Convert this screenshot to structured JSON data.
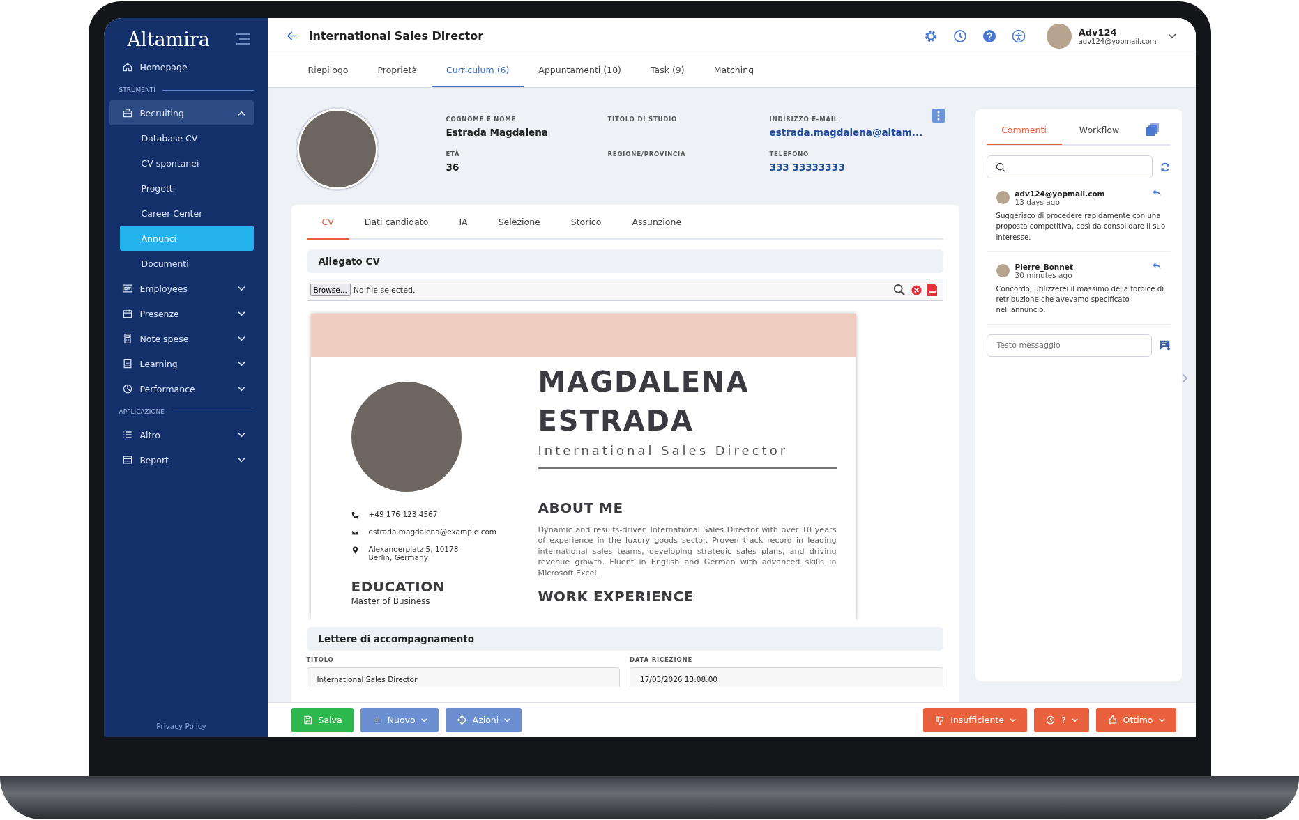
{
  "app": {
    "logo": "Altamira"
  },
  "sidebar": {
    "items": [
      {
        "kind": "link",
        "label": "Homepage"
      },
      {
        "kind": "section",
        "label": "STRUMENTI"
      },
      {
        "kind": "menu",
        "label": "Recruiting",
        "expanded": true,
        "children": [
          {
            "label": "Database CV",
            "selected": false
          },
          {
            "label": "CV spontanei",
            "selected": false
          },
          {
            "label": "Progetti",
            "selected": false
          },
          {
            "label": "Career Center",
            "selected": false
          },
          {
            "label": "Annunci",
            "selected": true
          },
          {
            "label": "Documenti",
            "selected": false
          }
        ]
      },
      {
        "kind": "menu",
        "label": "Employees",
        "expanded": false
      },
      {
        "kind": "menu",
        "label": "Presenze",
        "expanded": false
      },
      {
        "kind": "menu",
        "label": "Note spese",
        "expanded": false
      },
      {
        "kind": "menu",
        "label": "Learning",
        "expanded": false
      },
      {
        "kind": "menu",
        "label": "Performance",
        "expanded": false
      },
      {
        "kind": "section",
        "label": "APPLICAZIONE"
      },
      {
        "kind": "menu",
        "label": "Altro",
        "expanded": false
      },
      {
        "kind": "menu",
        "label": "Report",
        "expanded": false
      }
    ],
    "footer": "Privacy Policy"
  },
  "header": {
    "title": "International Sales Director",
    "user": {
      "name": "Adv124",
      "email": "adv124@yopmail.com"
    }
  },
  "tabs": [
    {
      "label": "Riepilogo",
      "selected": false
    },
    {
      "label": "Proprietà",
      "selected": false
    },
    {
      "label": "Curriculum (6)",
      "selected": true
    },
    {
      "label": "Appuntamenti (10)",
      "selected": false
    },
    {
      "label": "Task (9)",
      "selected": false
    },
    {
      "label": "Matching",
      "selected": false
    }
  ],
  "profile": {
    "fields": [
      {
        "label": "COGNOME E NOME",
        "value": "Estrada Magdalena",
        "kind": "text"
      },
      {
        "label": "TITOLO DI STUDIO"
      },
      {
        "label": "INDIRIZZO E-MAIL",
        "value": "estrada.magdalena@altam...",
        "kind": "link"
      },
      {
        "label": "ETÀ",
        "value": "36",
        "kind": "text"
      },
      {
        "label": "REGIONE/PROVINCIA"
      },
      {
        "label": "TELEFONO",
        "value": "333 33333333",
        "kind": "link"
      }
    ]
  },
  "subtabs": [
    {
      "label": "CV",
      "selected": true
    },
    {
      "label": "Dati candidato",
      "selected": false
    },
    {
      "label": "IA",
      "selected": false
    },
    {
      "label": "Selezione",
      "selected": false
    },
    {
      "label": "Storico",
      "selected": false
    },
    {
      "label": "Assunzione",
      "selected": false
    }
  ],
  "attachment": {
    "title": "Allegato CV",
    "button": "Browse...",
    "file_text": "No file selected."
  },
  "cv_document": {
    "name_lines": [
      "MAGDALENA",
      "ESTRADA"
    ],
    "role": "International Sales Director",
    "contacts": [
      {
        "kind": "phone",
        "lines": [
          "+49 176 123 4567"
        ]
      },
      {
        "kind": "email",
        "lines": [
          "estrada.magdalena@example.com"
        ]
      },
      {
        "kind": "address",
        "lines": [
          "Alexanderplatz 5, 10178",
          "Berlin, Germany"
        ]
      }
    ],
    "education_heading": "EDUCATION",
    "education_text": "Master of Business",
    "about_heading": "ABOUT ME",
    "about_text": "Dynamic and results-driven International Sales Director with over 10 years of experience in the luxury goods sector. Proven track record in leading international sales teams, developing strategic sales plans, and driving revenue growth. Fluent in English and German with advanced skills in Microsoft Excel.",
    "work_heading": "WORK EXPERIENCE"
  },
  "cover_letters": {
    "title": "Lettere di accompagnamento",
    "fields": [
      {
        "label": "TITOLO",
        "value": "International Sales Director"
      },
      {
        "label": "DATA RICEZIONE",
        "value": "17/03/2026 13:08:00"
      }
    ]
  },
  "comments_panel": {
    "tabs": [
      {
        "label": "Commenti",
        "selected": true
      },
      {
        "label": "Workflow",
        "selected": false
      }
    ],
    "comments": [
      {
        "author": "adv124@yopmail.com",
        "time": "13 days ago",
        "text": "Suggerisco di procedere rapidamente con una proposta competitiva, così da consolidare il suo interesse."
      },
      {
        "author": "Pierre_Bonnet",
        "time": "30 minutes ago",
        "text": "Concordo, utilizzerei il massimo della forbice di retribuzione che avevamo specificato nell'annuncio."
      }
    ],
    "message_placeholder": "Testo messaggio"
  },
  "actions": [
    {
      "label": "Salva",
      "kind": "success",
      "dropdown": false
    },
    {
      "label": "Nuovo",
      "kind": "primary",
      "dropdown": true
    },
    {
      "label": "Azioni",
      "kind": "primary",
      "dropdown": true
    },
    {
      "label": "Insufficiente",
      "kind": "danger",
      "dropdown": true
    },
    {
      "label": "?",
      "kind": "danger",
      "dropdown": true
    },
    {
      "label": "Ottimo",
      "kind": "danger",
      "dropdown": true
    }
  ]
}
